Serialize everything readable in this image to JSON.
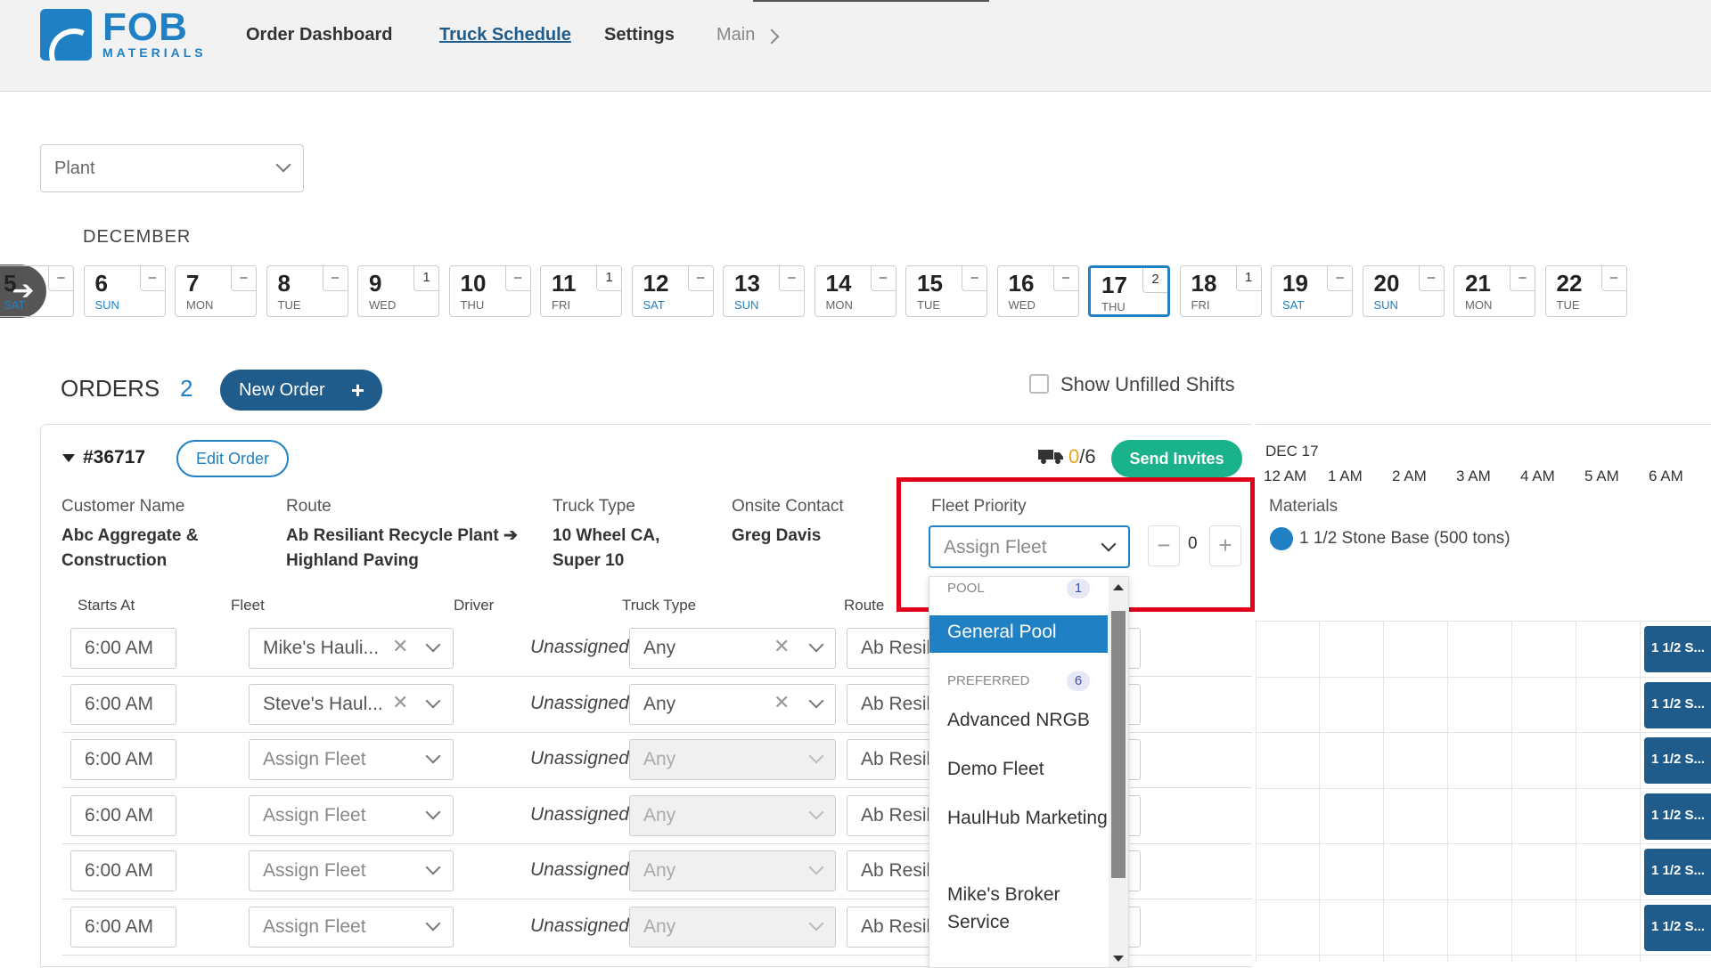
{
  "brand": {
    "name": "FOB",
    "sub": "MATERIALS",
    "color": "#1f80c4"
  },
  "nav": {
    "order_dashboard": "Order Dashboard",
    "truck_schedule": "Truck Schedule",
    "settings": "Settings",
    "main": "Main"
  },
  "filters": {
    "plant_placeholder": "Plant"
  },
  "calendar": {
    "month": "DECEMBER",
    "days": [
      {
        "num": "5",
        "dow": "SAT",
        "count": "–",
        "weekend": true
      },
      {
        "num": "6",
        "dow": "SUN",
        "count": "–",
        "weekend": true
      },
      {
        "num": "7",
        "dow": "MON",
        "count": "–",
        "weekend": false
      },
      {
        "num": "8",
        "dow": "TUE",
        "count": "–",
        "weekend": false
      },
      {
        "num": "9",
        "dow": "WED",
        "count": "1",
        "weekend": false
      },
      {
        "num": "10",
        "dow": "THU",
        "count": "–",
        "weekend": false
      },
      {
        "num": "11",
        "dow": "FRI",
        "count": "1",
        "weekend": false
      },
      {
        "num": "12",
        "dow": "SAT",
        "count": "–",
        "weekend": true
      },
      {
        "num": "13",
        "dow": "SUN",
        "count": "–",
        "weekend": true
      },
      {
        "num": "14",
        "dow": "MON",
        "count": "–",
        "weekend": false
      },
      {
        "num": "15",
        "dow": "TUE",
        "count": "–",
        "weekend": false
      },
      {
        "num": "16",
        "dow": "WED",
        "count": "–",
        "weekend": false
      },
      {
        "num": "17",
        "dow": "THU",
        "count": "2",
        "weekend": false,
        "selected": true
      },
      {
        "num": "18",
        "dow": "FRI",
        "count": "1",
        "weekend": false
      },
      {
        "num": "19",
        "dow": "SAT",
        "count": "–",
        "weekend": true
      },
      {
        "num": "20",
        "dow": "SUN",
        "count": "–",
        "weekend": true
      },
      {
        "num": "21",
        "dow": "MON",
        "count": "–",
        "weekend": false
      },
      {
        "num": "22",
        "dow": "TUE",
        "count": "–",
        "weekend": false
      }
    ]
  },
  "orders": {
    "title": "ORDERS",
    "count": "2",
    "new_order_label": "New Order",
    "show_unfilled_label": "Show Unfilled Shifts"
  },
  "order": {
    "number": "#36717",
    "edit_label": "Edit Order",
    "trucks_filled": "0",
    "trucks_total": "/6",
    "send_invites_label": "Send Invites",
    "customer_label": "Customer Name",
    "customer_line1": "Abc Aggregate &",
    "customer_line2": "Construction",
    "route_label": "Route",
    "route_line1": "Ab Resiliant Recycle Plant",
    "route_line2": "Highland Paving",
    "truck_type_label": "Truck Type",
    "truck_type_line1": "10 Wheel CA,",
    "truck_type_line2": "Super 10",
    "onsite_label": "Onsite Contact",
    "onsite_value": "Greg Davis",
    "fleet_priority_label": "Fleet Priority",
    "fleet_priority_placeholder": "Assign Fleet",
    "fleet_priority_step": "0",
    "materials_label": "Materials",
    "material": "1 1/2 Stone Base (500 tons)"
  },
  "timeline": {
    "date": "DEC 17",
    "hours": [
      "12 AM",
      "1 AM",
      "2 AM",
      "3 AM",
      "4 AM",
      "5 AM",
      "6 AM"
    ]
  },
  "shift_headers": {
    "starts_at": "Starts At",
    "fleet": "Fleet",
    "driver": "Driver",
    "truck_type": "Truck Type",
    "route": "Route"
  },
  "shifts": [
    {
      "start": "6:00 AM",
      "fleet": "Mike's Hauli...",
      "fleet_set": true,
      "driver": "Unassigned",
      "truck_type": "Any",
      "truck_set": true,
      "route": "Ab Resil",
      "chip": "1 1/2 S..."
    },
    {
      "start": "6:00 AM",
      "fleet": "Steve's Haul...",
      "fleet_set": true,
      "driver": "Unassigned",
      "truck_type": "Any",
      "truck_set": true,
      "route": "Ab Resil",
      "chip": "1 1/2 S..."
    },
    {
      "start": "6:00 AM",
      "fleet": "Assign Fleet",
      "fleet_set": false,
      "driver": "Unassigned",
      "truck_type": "Any",
      "truck_set": false,
      "route": "Ab Resil",
      "chip": "1 1/2 S..."
    },
    {
      "start": "6:00 AM",
      "fleet": "Assign Fleet",
      "fleet_set": false,
      "driver": "Unassigned",
      "truck_type": "Any",
      "truck_set": false,
      "route": "Ab Resil",
      "chip": "1 1/2 S..."
    },
    {
      "start": "6:00 AM",
      "fleet": "Assign Fleet",
      "fleet_set": false,
      "driver": "Unassigned",
      "truck_type": "Any",
      "truck_set": false,
      "route": "Ab Resil",
      "chip": "1 1/2 S..."
    },
    {
      "start": "6:00 AM",
      "fleet": "Assign Fleet",
      "fleet_set": false,
      "driver": "Unassigned",
      "truck_type": "Any",
      "truck_set": false,
      "route": "Ab Resil",
      "chip": "1 1/2 S..."
    }
  ],
  "fleet_dropdown": {
    "pool_label": "POOL",
    "pool_count": "1",
    "pool_option": "General Pool",
    "preferred_label": "PREFERRED",
    "preferred_count": "6",
    "options": [
      "Advanced NRGB",
      "Demo Fleet",
      "HaulHub Marketing",
      "Mike's Broker Service"
    ]
  },
  "icons": [
    "logo-icon",
    "chevron-right-icon",
    "chevron-down-icon",
    "arrow-left-icon",
    "plus-icon",
    "truck-icon",
    "caret-down-icon",
    "close-icon",
    "minus-icon",
    "arrow-right-icon"
  ],
  "colors": {
    "accent": "#1f80c4",
    "dark_accent": "#1f5c8c",
    "success": "#19b28a",
    "warning": "#f0a020",
    "highlight": "#e0001b"
  }
}
